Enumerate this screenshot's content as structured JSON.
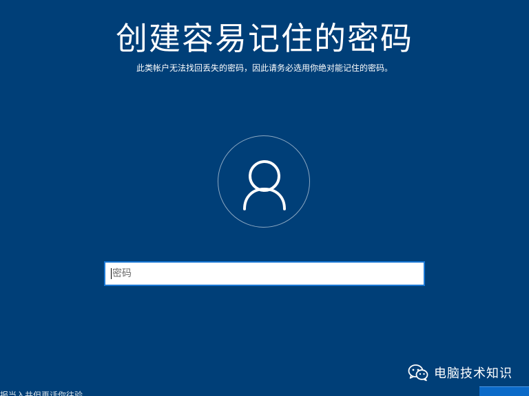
{
  "header": {
    "title": "创建容易记住的密码",
    "subtitle": "此类帐户无法找回丢失的密码，因此请务必选用你绝对能记住的密码。"
  },
  "avatar": {
    "icon": "user-avatar-icon"
  },
  "password_field": {
    "placeholder": "密码",
    "value": ""
  },
  "watermark": {
    "icon": "wechat-icon",
    "text": "电脑技术知识"
  },
  "footer": {
    "partial_text": "报当入共但再话你往验"
  },
  "colors": {
    "background": "#003f78",
    "input_border": "#1a78d6",
    "button": "#0b6ac8"
  }
}
